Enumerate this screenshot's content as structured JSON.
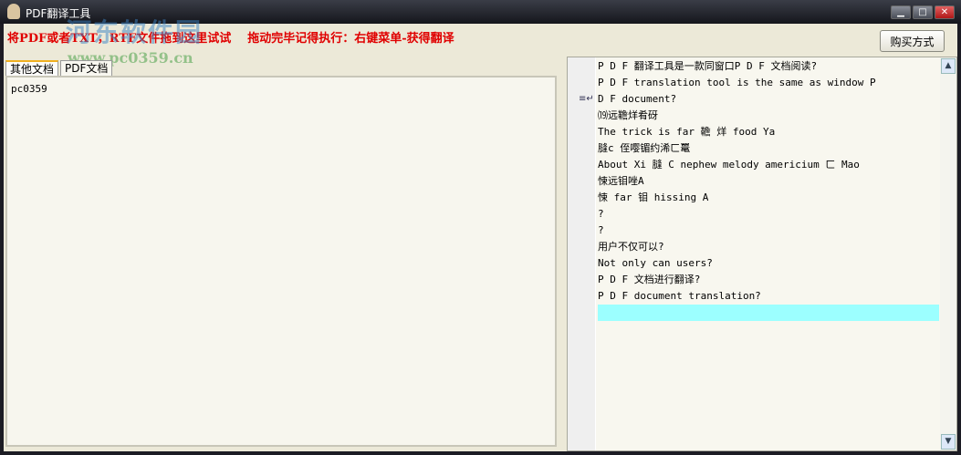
{
  "window": {
    "title": "PDF翻译工具",
    "controls": {
      "minimize": "▁",
      "maximize": "□",
      "close": "✕"
    }
  },
  "watermark": {
    "name": "河东软件园",
    "url": "www.pc0359.cn"
  },
  "hint": {
    "part1": "将PDF或者TXT，RTF文件拖到这里试试",
    "part2": "拖动完毕记得执行：右键菜单-获得翻译"
  },
  "buy_button": "购买方式",
  "tabs": [
    {
      "label": "其他文档",
      "active": true
    },
    {
      "label": "PDF文档",
      "active": false
    }
  ],
  "left_text": "pc0359",
  "right_lines": [
    "P D F 翻译工具是一款同窗口P D F 文档阅读?",
    "P D F translation tool is the same as window P",
    " D F document?",
    "⒆远韂烊肴砑",
    "The trick is far 韂 烊 food Ya",
    "膖c 侄嘤镅约浠ㄈ鼍",
    "About Xi 膖 C  nephew melody americium ㄈ Mao",
    "悚远钼唑A",
    "悚 far 钼 hissing A",
    "?",
    "?",
    "用户不仅可以?",
    "Not only can users?",
    "P D F 文档进行翻译?",
    "P D F document translation?",
    ""
  ],
  "highlighted_line": 15
}
